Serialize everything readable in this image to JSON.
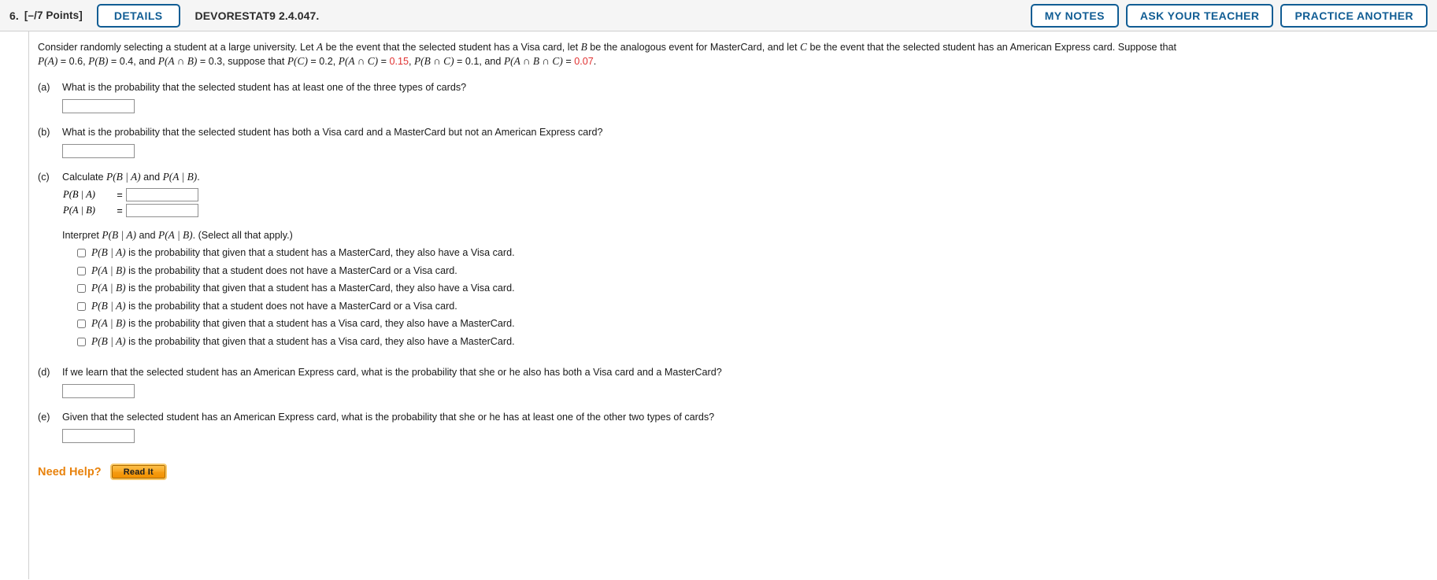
{
  "header": {
    "question_number": "6.",
    "points": "[–/7 Points]",
    "details_button": "DETAILS",
    "question_code": "DEVORESTAT9 2.4.047.",
    "my_notes_button": "MY NOTES",
    "ask_your_teacher_button": "ASK YOUR TEACHER",
    "practice_another_button": "PRACTICE ANOTHER",
    "accent_color": "#115d94",
    "bar_background": "#f5f5f5"
  },
  "statement": {
    "line1_a": "Consider randomly selecting a student at a large university. Let ",
    "var_A": "A",
    "line1_b": " be the event that the selected student has a Visa card, let ",
    "var_B": "B",
    "line1_c": " be the analogous event for MasterCard, and let ",
    "var_C": "C",
    "line1_d": " be the event that the selected student has an American Express card. Suppose that",
    "line2_p1": "P(A)",
    "line2_v1": " = 0.6, ",
    "line2_p2": "P(B)",
    "line2_v2": " = 0.4, and ",
    "line2_p3": "P(A ∩ B)",
    "line2_v3": " = 0.3, suppose that ",
    "line2_p4": "P(C)",
    "line2_v4": " = 0.2, ",
    "line2_p5": "P(A ∩ C)",
    "line2_eq5": " = ",
    "line2_red5": "0.15",
    "line2_v5": ", ",
    "line2_p6": "P(B ∩ C)",
    "line2_v6": " = 0.1, and ",
    "line2_p7": "P(A ∩ B ∩ C)",
    "line2_eq7": " = ",
    "line2_red7": "0.07",
    "line2_end": ".",
    "highlight_color": "#e03131"
  },
  "parts": {
    "a": {
      "label": "(a)",
      "text": "What is the probability that the selected student has at least one of the three types of cards?",
      "answer_value": "",
      "answer_placeholder": ""
    },
    "b": {
      "label": "(b)",
      "text": "What is the probability that the selected student has both a Visa card and a MasterCard but not an American Express card?",
      "answer_value": "",
      "answer_placeholder": ""
    },
    "c": {
      "label": "(c)",
      "text_pre": "Calculate ",
      "text_p1": "P(B | A)",
      "text_mid": " and ",
      "text_p2": "P(A | B)",
      "text_post": ".",
      "row1_label": "P(B | A)",
      "row1_eq": "=",
      "row1_value": "",
      "row2_label": "P(A | B)",
      "row2_eq": "=",
      "row2_value": "",
      "interpret_pre": "Interpret ",
      "interpret_p1": "P(B | A)",
      "interpret_mid": " and ",
      "interpret_p2": "P(A | B)",
      "interpret_post": ". (Select all that apply.)",
      "choices": [
        {
          "expr": "P(B | A)",
          "text": " is the probability that given that a student has a MasterCard, they also have a Visa card.",
          "checked": false
        },
        {
          "expr": "P(A | B)",
          "text": " is the probability that a student does not have a MasterCard or a Visa card.",
          "checked": false
        },
        {
          "expr": "P(A | B)",
          "text": " is the probability that given that a student has a MasterCard, they also have a Visa card.",
          "checked": false
        },
        {
          "expr": "P(B | A)",
          "text": " is the probability that a student does not have a MasterCard or a Visa card.",
          "checked": false
        },
        {
          "expr": "P(A | B)",
          "text": " is the probability that given that a student has a Visa card, they also have a MasterCard.",
          "checked": false
        },
        {
          "expr": "P(B | A)",
          "text": " is the probability that given that a student has a Visa card, they also have a MasterCard.",
          "checked": false
        }
      ]
    },
    "d": {
      "label": "(d)",
      "text": "If we learn that the selected student has an American Express card, what is the probability that she or he also has both a Visa card and a MasterCard?",
      "answer_value": "",
      "answer_placeholder": ""
    },
    "e": {
      "label": "(e)",
      "text": "Given that the selected student has an American Express card, what is the probability that she or he has at least one of the other two types of cards?",
      "answer_value": "",
      "answer_placeholder": ""
    }
  },
  "footer": {
    "need_help_label": "Need Help?",
    "read_it_button": "Read It",
    "need_help_color": "#e8820c"
  }
}
